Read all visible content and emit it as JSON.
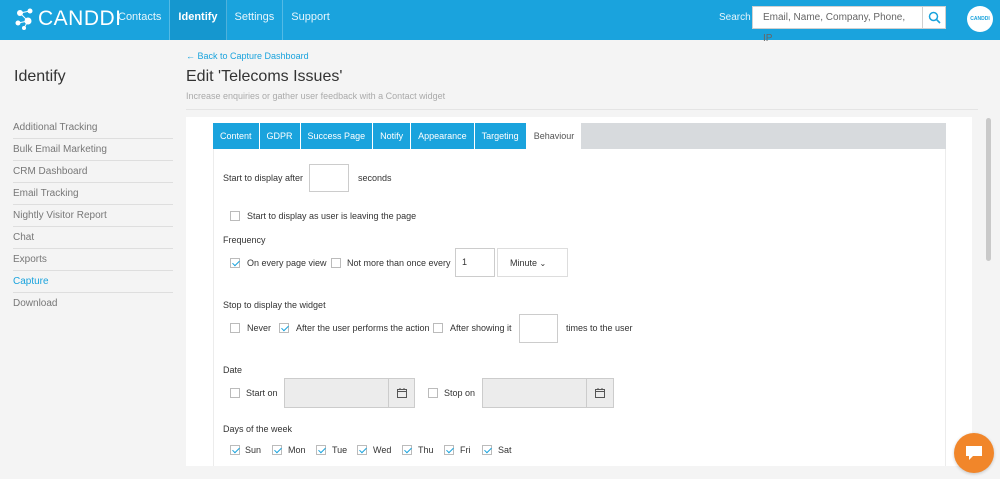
{
  "app": {
    "logo_text": "CANDDI",
    "avatar_text": "CANDDI"
  },
  "nav": {
    "items": [
      {
        "label": "Contacts",
        "active": false
      },
      {
        "label": "Identify",
        "active": true
      },
      {
        "label": "Settings",
        "active": false
      },
      {
        "label": "Support",
        "active": false
      }
    ],
    "search_label": "Search",
    "search_placeholder": "Email, Name, Company, Phone, IP"
  },
  "sidebar": {
    "title": "Identify",
    "items": [
      {
        "label": "Additional Tracking"
      },
      {
        "label": "Bulk Email Marketing"
      },
      {
        "label": "CRM Dashboard"
      },
      {
        "label": "Email Tracking"
      },
      {
        "label": "Nightly Visitor Report"
      },
      {
        "label": "Chat"
      },
      {
        "label": "Exports"
      },
      {
        "label": "Capture",
        "active": true
      },
      {
        "label": "Download"
      }
    ]
  },
  "header": {
    "back_link": "Back to Capture Dashboard",
    "title": "Edit 'Telecoms Issues'",
    "subtitle": "Increase enquiries or gather user feedback with a Contact widget"
  },
  "tabs": [
    {
      "label": "Content"
    },
    {
      "label": "GDPR"
    },
    {
      "label": "Success Page"
    },
    {
      "label": "Notify"
    },
    {
      "label": "Appearance"
    },
    {
      "label": "Targeting"
    },
    {
      "label": "Behaviour",
      "active": true
    }
  ],
  "form": {
    "start_after_label": "Start to display after",
    "start_after_value": "",
    "seconds_label": "seconds",
    "leaving_label": "Start to display as user is leaving the page",
    "leaving_checked": false,
    "frequency_heading": "Frequency",
    "every_page_label": "On every page view",
    "every_page_checked": true,
    "not_more_label": "Not more than once every",
    "not_more_checked": false,
    "interval_value": "1",
    "interval_unit": "Minute",
    "stop_heading": "Stop to display the widget",
    "never_label": "Never",
    "never_checked": false,
    "after_action_label": "After the user performs the action",
    "after_action_checked": true,
    "after_showing_label": "After showing it",
    "after_showing_checked": false,
    "times_value": "",
    "times_label": "times to the user",
    "date_heading": "Date",
    "start_on_label": "Start on",
    "start_on_checked": false,
    "stop_on_label": "Stop on",
    "stop_on_checked": false,
    "days_heading": "Days of the week",
    "days": [
      {
        "label": "Sun",
        "checked": true
      },
      {
        "label": "Mon",
        "checked": true
      },
      {
        "label": "Tue",
        "checked": true
      },
      {
        "label": "Wed",
        "checked": true
      },
      {
        "label": "Thu",
        "checked": true
      },
      {
        "label": "Fri",
        "checked": true
      },
      {
        "label": "Sat",
        "checked": true
      }
    ]
  },
  "colors": {
    "brand": "#1aa3dd",
    "chat": "#f1862a"
  }
}
